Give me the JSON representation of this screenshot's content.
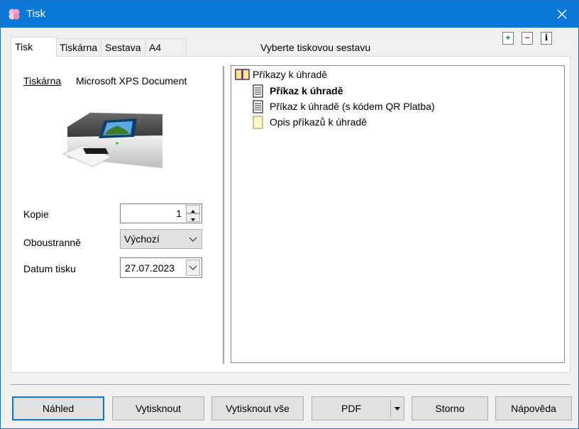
{
  "window": {
    "title": "Tisk"
  },
  "tabs": [
    {
      "label": "Tisk"
    },
    {
      "label": "Tiskárna"
    },
    {
      "label": "Sestava"
    },
    {
      "label": "A4"
    }
  ],
  "report_heading": "Vyberte tiskovou sestavu",
  "tree_toolbar": {
    "expand": "+",
    "collapse": "−",
    "info": "i"
  },
  "printer": {
    "label": "Tiskárna",
    "name": "Microsoft XPS Document"
  },
  "copies": {
    "label": "Kopie",
    "value": "1"
  },
  "duplex": {
    "label": "Oboustranně",
    "value": "Výchozí"
  },
  "print_date": {
    "label": "Datum tisku",
    "value": "27.07.2023"
  },
  "tree": {
    "root": "Příkazy k úhradě",
    "items": [
      {
        "label": "Příkaz k úhradě",
        "selected": true
      },
      {
        "label": "Příkaz k úhradě (s kódem QR Platba)"
      },
      {
        "label": "Opis příkazů k úhradě"
      }
    ]
  },
  "buttons": {
    "preview": "Náhled",
    "print": "Vytisknout",
    "print_all": "Vytisknout vše",
    "pdf": "PDF",
    "cancel": "Storno",
    "help": "Nápověda"
  }
}
